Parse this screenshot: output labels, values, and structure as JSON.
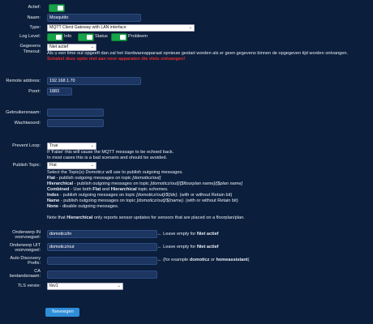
{
  "labels": {
    "active": "Actief:",
    "name": "Naam:",
    "type": "Type:",
    "log_level": "Log Level:",
    "data_timeout_1": "Gegevens",
    "data_timeout_2": "Timeout:",
    "remote_address": "Remote address:",
    "port": "Poort:",
    "username": "Gebruikersnaam:",
    "password": "Wachtwoord:",
    "prevent_loop": "Prevent Loop:",
    "publish_topic": "Publish Topic:",
    "sub_in_1": "Onderwerp IN",
    "sub_in_2": "voorvoegsel:",
    "sub_out_1": "Onderwerp UIT",
    "sub_out_2": "voorvoegsel:",
    "auto_disc_1": "Auto Discovery",
    "auto_disc_2": "Prefix:",
    "ca_1": "CA",
    "ca_2": "bestandsnaam:",
    "tls": "TLS versie:"
  },
  "values": {
    "name": "Mosquitto",
    "type": "MQTT Client Gateway with LAN interface",
    "data_timeout": "Niet actief",
    "remote_address": "192.168.1.70",
    "port": "1883",
    "username": "",
    "password": "",
    "prevent_loop": "True",
    "publish_topic": "Flat",
    "sub_in": "domoticz/in",
    "sub_out": "domoticz/out",
    "auto_disc": "",
    "ca": "",
    "tls": "tlsv1"
  },
  "log_level": {
    "info": "Info",
    "status": "Status",
    "error": "Probleem"
  },
  "timeout_help": {
    "line1": "Als u een time out opgeeft dan zal het Hardwareapparaat opnieuw gestart worden als er geen gegevens binnen de opgegeven tijd worden ontvangen.",
    "line2": "Schakel deze optie niet aan voor apparaten die vlets ontvangen!"
  },
  "prevent_loop_help": {
    "line1": "If 'False' this will cause the MQTT message to be echoed back.",
    "line2": "In most cases this is a bad scenario and should be avoided."
  },
  "publish_help": {
    "intro": "Select the Topic(s) Domoticz will use to publish outgoing messages.",
    "flat_k": "Flat",
    "flat_v": " - publish outgoing messages on topic ",
    "flat_t": "[domoticz/out]",
    "hier_k": "Hierarchical",
    "hier_v": " - publish outgoing messages on topic ",
    "hier_t": "[domoticz/out]/[$floorplan name]/[$plan name]",
    "comb_k": "Combined",
    "comb_v1": " - Use both ",
    "comb_flat": "Flat",
    "comb_and": " and ",
    "comb_hier": "Hierarchical",
    "comb_v2": " topic schemes.",
    "idx_k": "Index",
    "idx_v": " - publish outgoing messages on topic ",
    "idx_t": "[domoticz/out]/${idx}",
    "idx_r": ". (with or without Retain bit)",
    "name_k": "Name",
    "name_v": " - publish outgoing messages on topic ",
    "name_t": "[domoticz/out]/${name}",
    "name_r": ". (with or without Retain bit)",
    "none_k": "None",
    "none_v": " - disable outgoing messages.",
    "note1": "Note that ",
    "note_b": "Hierarchical",
    "note2": " only reports sensor updates for sensors that are placed on a floorplan/plan."
  },
  "hints": {
    "in_pre": "← Leave empty for ",
    "in_b": "Niet actief",
    "out_pre": "← Leave empty for ",
    "out_b": "Niet actief",
    "ad_pre": "← (for example ",
    "ad_b1": "domoticz",
    "ad_mid": " or ",
    "ad_b2": "homeassistant",
    "ad_post": ")"
  },
  "buttons": {
    "save": "Toevoegen"
  },
  "colors": {
    "background": "#0b1e3b",
    "toggle_on": "#17a34a",
    "warning": "#e52b2b",
    "button": "#2f8ed8"
  }
}
